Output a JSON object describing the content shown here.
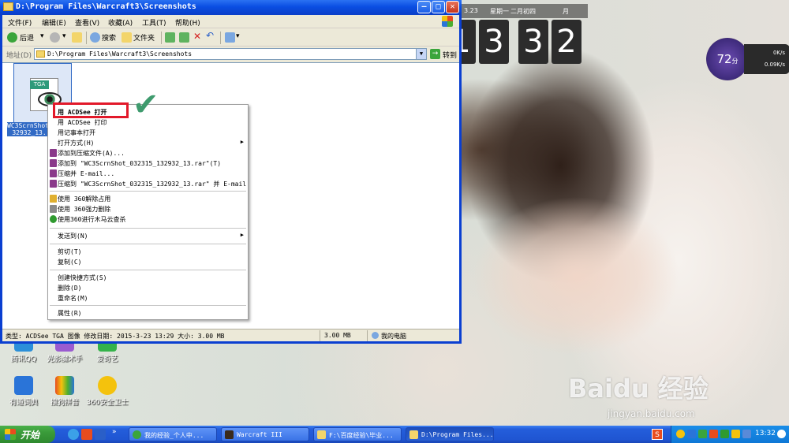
{
  "window": {
    "title": "D:\\Program Files\\Warcraft3\\Screenshots"
  },
  "menubar": [
    "文件(F)",
    "编辑(E)",
    "查看(V)",
    "收藏(A)",
    "工具(T)",
    "帮助(H)"
  ],
  "toolbar": {
    "back": "后退",
    "search": "搜索",
    "folders": "文件夹"
  },
  "address": {
    "label": "地址(D)",
    "value": "D:\\Program Files\\Warcraft3\\Screenshots",
    "go": "转到"
  },
  "file": {
    "badge": "TGA",
    "name_line1": "WC3ScrnShot_",
    "name_line2": "32932_13."
  },
  "context_menu": {
    "items": [
      "用 ACDSee 打开",
      "用 ACDSee 打印",
      "用记事本打开",
      "打开方式(H)",
      "添加到压缩文件(A)...",
      "添加到 \"WC3ScrnShot_032315_132932_13.rar\"(T)",
      "压缩并 E-mail...",
      "压缩到 \"WC3ScrnShot_032315_132932_13.rar\" 并 E-mail",
      "使用 360解除占用",
      "使用 360强力删除",
      "使用360进行木马云查杀",
      "发送到(N)",
      "剪切(T)",
      "复制(C)",
      "创建快捷方式(S)",
      "删除(D)",
      "重命名(M)",
      "属性(R)"
    ]
  },
  "statusbar": {
    "info": "类型: ACDSee TGA 图像 修改日期: 2015-3-23 13:29 大小: 3.00 MB",
    "size": "3.00 MB",
    "location": "我的电脑"
  },
  "clock": {
    "date": "3.23",
    "weekday": "星期一",
    "lunar": "二月初四",
    "month_label": "月",
    "digits": [
      "1",
      "3",
      "3",
      "2"
    ]
  },
  "speed_widget": {
    "value": "72",
    "unit": "分",
    "up": "0K/s",
    "down": "0.09K/s"
  },
  "desktop_icons": [
    {
      "label": "腾讯QQ"
    },
    {
      "label": "光影魔术手"
    },
    {
      "label": "爱奇艺"
    },
    {
      "label": "有道词典"
    },
    {
      "label": "搜狗拼音"
    },
    {
      "label": "360安全卫士"
    }
  ],
  "watermark": {
    "brand": "Baidu 经验",
    "url": "jingyan.baidu.com"
  },
  "taskbar": {
    "start": "开始",
    "tasks": [
      "我的经验_个人中...",
      "Warcraft III",
      "F:\\百度经验\\毕业...",
      "D:\\Program Files..."
    ],
    "time": "13:32"
  },
  "colors": {
    "titlebar": "#0a4ee2",
    "highlight": "#e2192a",
    "check": "#3f9b6e",
    "selection": "#316ac5"
  }
}
